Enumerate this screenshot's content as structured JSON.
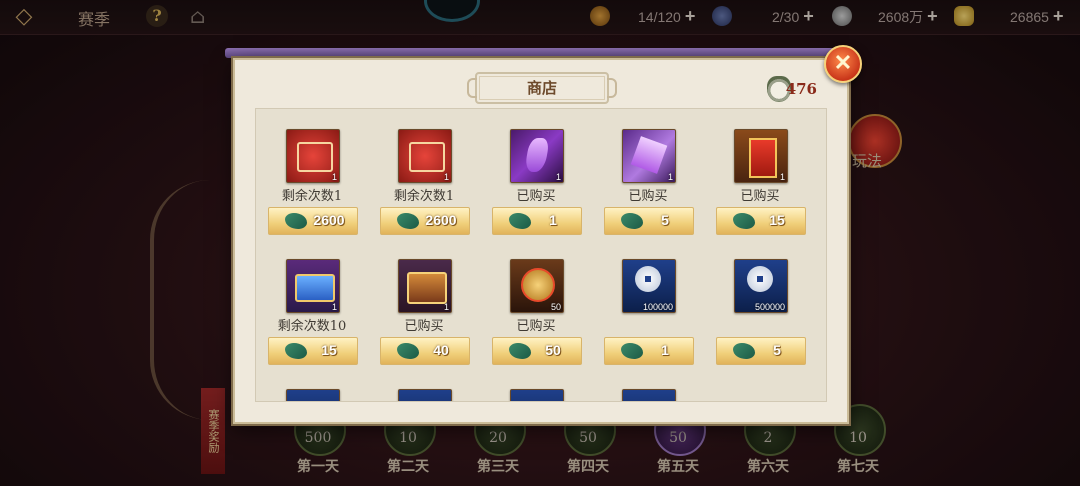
{
  "topbar": {
    "back": "◇",
    "season_title": "赛季",
    "help": "?",
    "resources": [
      {
        "value": "14/120",
        "plus": "+"
      },
      {
        "value": "2/30",
        "plus": "+"
      },
      {
        "value": "2608万",
        "plus": "+"
      },
      {
        "value": "26865",
        "plus": "+"
      }
    ]
  },
  "side": {
    "play_label": "玩法",
    "season_reward": "赛季奖励"
  },
  "days": [
    {
      "count": "500",
      "label": "第一天"
    },
    {
      "count": "10",
      "label": "第二天"
    },
    {
      "count": "20",
      "label": "第三天"
    },
    {
      "count": "50",
      "label": "第四天"
    },
    {
      "count": "50",
      "label": "第五天"
    },
    {
      "count": "2",
      "label": "第六天"
    },
    {
      "count": "10",
      "label": "第七天"
    }
  ],
  "shop": {
    "title": "商店",
    "close": "✕",
    "currency": {
      "icon": "jade-pouch-icon",
      "value": "476"
    },
    "items": [
      {
        "art": "art-scroll",
        "qty": "1",
        "status": "剩余次数1",
        "price": "2600"
      },
      {
        "art": "art-scroll",
        "qty": "1",
        "status": "剩余次数1",
        "price": "2600"
      },
      {
        "art": "art-crystal",
        "qty": "1",
        "status": "已购买",
        "price": "1"
      },
      {
        "art": "art-crystal2",
        "qty": "1",
        "status": "已购买",
        "price": "5"
      },
      {
        "art": "art-banner",
        "qty": "1",
        "status": "已购买",
        "price": "15"
      },
      {
        "art": "art-chest-blue",
        "qty": "1",
        "status": "剩余次数10",
        "price": "15"
      },
      {
        "art": "art-chest-gold",
        "qty": "1",
        "status": "已购买",
        "price": "40"
      },
      {
        "art": "art-medal",
        "qty": "50",
        "status": "已购买",
        "price": "50"
      },
      {
        "art": "art-coin",
        "qty": "100000",
        "status": "",
        "price": "1"
      },
      {
        "art": "art-coin",
        "qty": "500000",
        "status": "",
        "price": "5"
      }
    ]
  }
}
